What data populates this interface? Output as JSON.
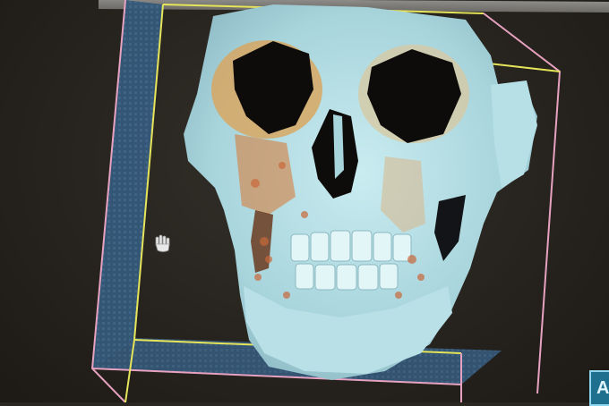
{
  "app": {
    "name": "3d-volume-viewer"
  },
  "viewer": {
    "render_mode": "volume-render",
    "subject": "skull",
    "colors": {
      "bone": "#a8d4dc",
      "bone_highlight": "#c9ecf0",
      "tissue": "#c9683a",
      "floor": "#365a77",
      "box_yellow": "#e5e45a",
      "box_pink": "#e6a2c0",
      "background": "#2a2620"
    }
  },
  "cursor": {
    "icon": "hand-cursor-icon"
  },
  "mode_button": {
    "label": "A"
  }
}
